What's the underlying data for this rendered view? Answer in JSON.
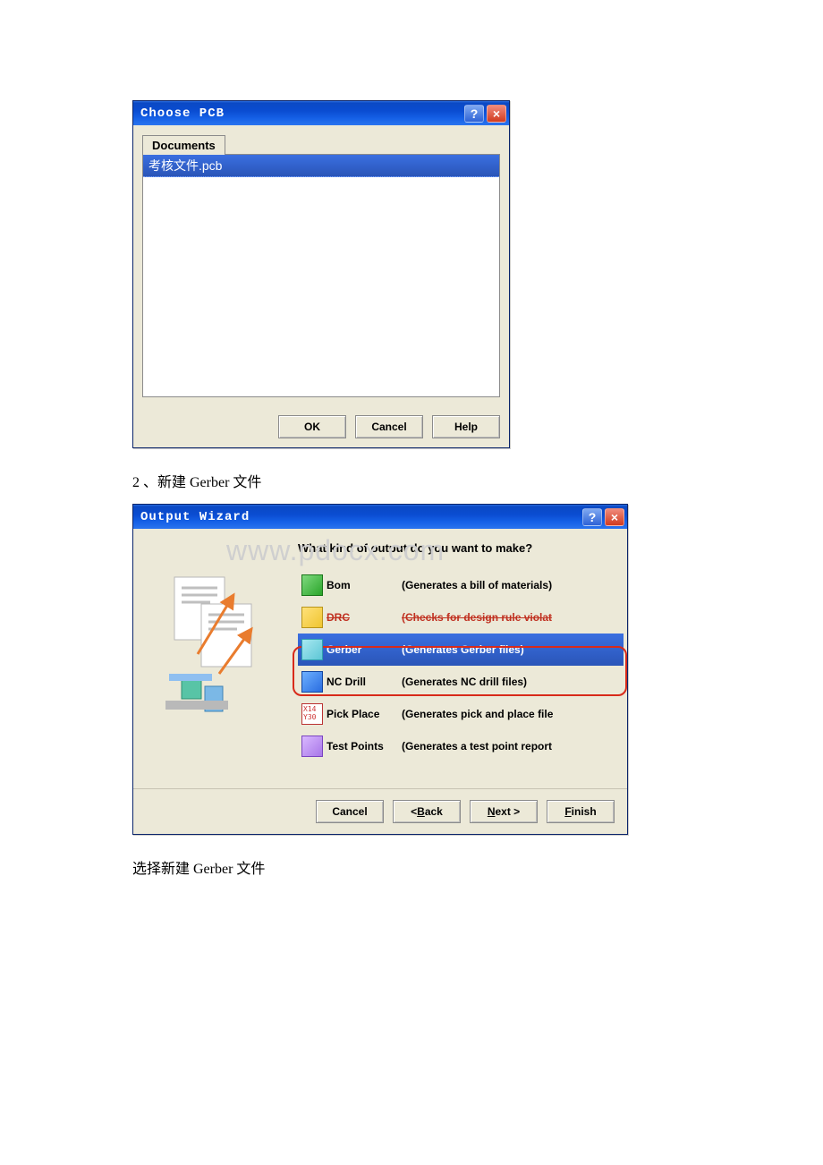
{
  "dialog1": {
    "title": "Choose PCB",
    "tab_label": "Documents",
    "list_item": "考核文件.pcb",
    "buttons": {
      "ok": "OK",
      "cancel": "Cancel",
      "help": "Help"
    }
  },
  "text": {
    "step2": "2 、新建 Gerber 文件",
    "select_gerber": "选择新建 Gerber 文件"
  },
  "dialog2": {
    "title": "Output Wizard",
    "heading": "What kind of output do you want to make?",
    "watermark": "www.pdocx.com",
    "options": [
      {
        "name": "Bom",
        "desc": "(Generates a bill of materials)",
        "icon": "ic-bom",
        "selected": false
      },
      {
        "name": "DRC",
        "desc": "(Checks for design rule violat",
        "icon": "ic-drc",
        "selected": false,
        "strike": true
      },
      {
        "name": "Gerber",
        "desc": "(Generates Gerber files)",
        "icon": "ic-gerber",
        "selected": true
      },
      {
        "name": "NC Drill",
        "desc": "(Generates NC drill files)",
        "icon": "ic-nc",
        "selected": false
      },
      {
        "name": "Pick Place",
        "desc": "(Generates pick and place file",
        "icon": "ic-pp",
        "selected": false
      },
      {
        "name": "Test Points",
        "desc": "(Generates a test point report",
        "icon": "ic-tp",
        "selected": false
      }
    ],
    "buttons": {
      "cancel": "Cancel",
      "back": "< Back",
      "next": "Next >",
      "finish": "Finish"
    }
  }
}
